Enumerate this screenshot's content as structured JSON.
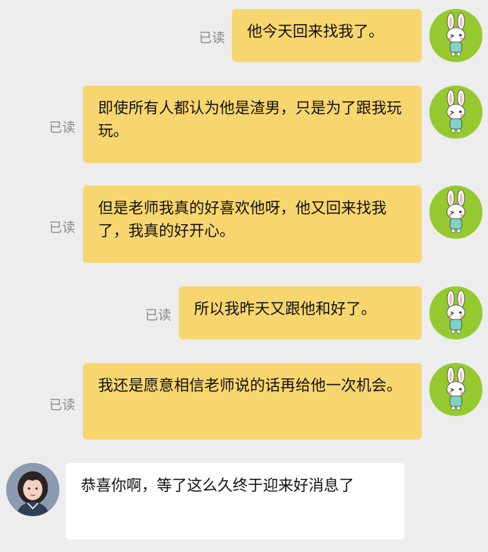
{
  "messages": [
    {
      "side": "out",
      "read": "已读",
      "text": "他今天回来找我了。",
      "avatar": "bunny-avatar"
    },
    {
      "side": "out",
      "read": "已读",
      "text": "即使所有人都认为他是渣男，只是为了跟我玩玩。",
      "avatar": "bunny-avatar"
    },
    {
      "side": "out",
      "read": "已读",
      "text": "但是老师我真的好喜欢他呀，他又回来找我了，我真的好开心。",
      "avatar": "bunny-avatar"
    },
    {
      "side": "out",
      "read": "已读",
      "text": "所以我昨天又跟他和好了。",
      "avatar": "bunny-avatar"
    },
    {
      "side": "out",
      "read": "已读",
      "text": "我还是愿意相信老师说的话再给他一次机会。",
      "avatar": "bunny-avatar"
    },
    {
      "side": "in",
      "text": "恭喜你啊，等了这么久终于迎来好消息了",
      "avatar": "teacher-avatar"
    }
  ],
  "colors": {
    "background": "#ededed",
    "outgoing_bubble": "#f8d66f",
    "incoming_bubble": "#ffffff",
    "bunny_avatar_bg": "#95c92f",
    "read_text": "#8a8a8a"
  }
}
